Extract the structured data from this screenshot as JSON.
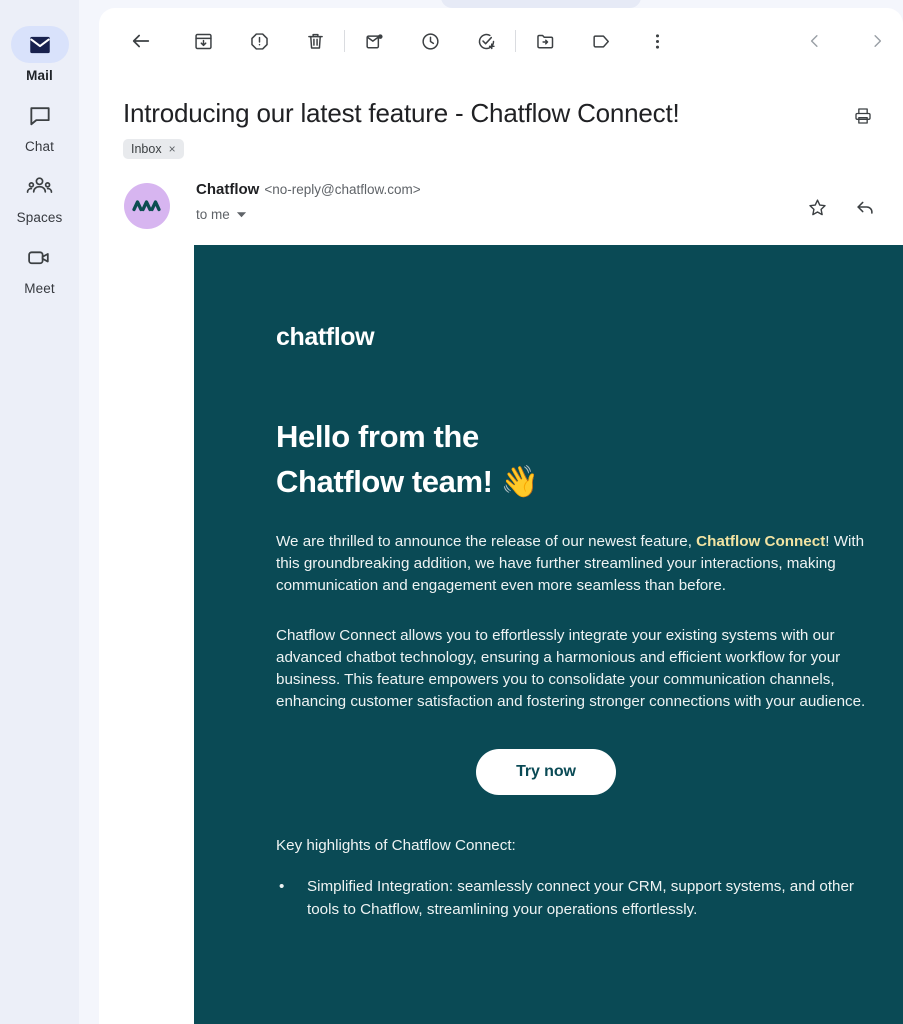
{
  "rail": {
    "items": [
      {
        "label": "Mail",
        "icon": "envelope-icon",
        "active": true
      },
      {
        "label": "Chat",
        "icon": "chat-bubble-icon",
        "active": false
      },
      {
        "label": "Spaces",
        "icon": "people-group-icon",
        "active": false
      },
      {
        "label": "Meet",
        "icon": "video-camera-icon",
        "active": false
      }
    ]
  },
  "toolbar": {
    "back": "Back",
    "archive": "Archive",
    "report_spam": "Report spam",
    "delete": "Delete",
    "mark_unread": "Mark as unread",
    "snooze": "Snooze",
    "add_to_tasks": "Add to tasks",
    "move_to": "Move to",
    "labels": "Labels",
    "more": "More",
    "prev": "Newer",
    "next": "Older"
  },
  "email": {
    "subject": "Introducing our latest feature - Chatflow Connect!",
    "label_chip": "Inbox",
    "label_chip_remove": "×",
    "print_label": "Print all",
    "sender_name": "Chatflow",
    "sender_email": "<no-reply@chatflow.com>",
    "recipient": "to me",
    "star_label": "Star",
    "reply_label": "Reply"
  },
  "body": {
    "brand": "chatflow",
    "hero_line1": "Hello from the",
    "hero_line2": "Chatflow team!",
    "hero_emoji": "👋",
    "p1_a": "We are thrilled to announce the release of our newest feature, ",
    "p1_highlight": "Chatflow Connect",
    "p1_b": "! With this groundbreaking addition, we have further streamlined your interactions, making communication and engagement even more seamless than before.",
    "p2": "Chatflow Connect allows you to effortlessly integrate your existing systems with our advanced chatbot technology, ensuring a harmonious and efficient workflow for your business. This feature empowers you to consolidate your communication channels, enhancing customer satisfaction and fostering stronger connections with your audience.",
    "cta": "Try now",
    "key_highlights_heading": "Key highlights of Chatflow Connect:",
    "bullets": [
      {
        "dot": "•",
        "text": "Simplified Integration: seamlessly connect your CRM, support systems, and other tools to Chatflow, streamlining your operations effortlessly."
      }
    ]
  },
  "colors": {
    "rail_bg": "#eceff8",
    "page_bg": "#f4f6fc",
    "active_pill": "#d9e2fb",
    "email_teal": "#0a4a55",
    "highlight_yellow": "#f2e3a2",
    "avatar_purple": "#d7b5f0",
    "chip_bg": "#e8eaed"
  }
}
